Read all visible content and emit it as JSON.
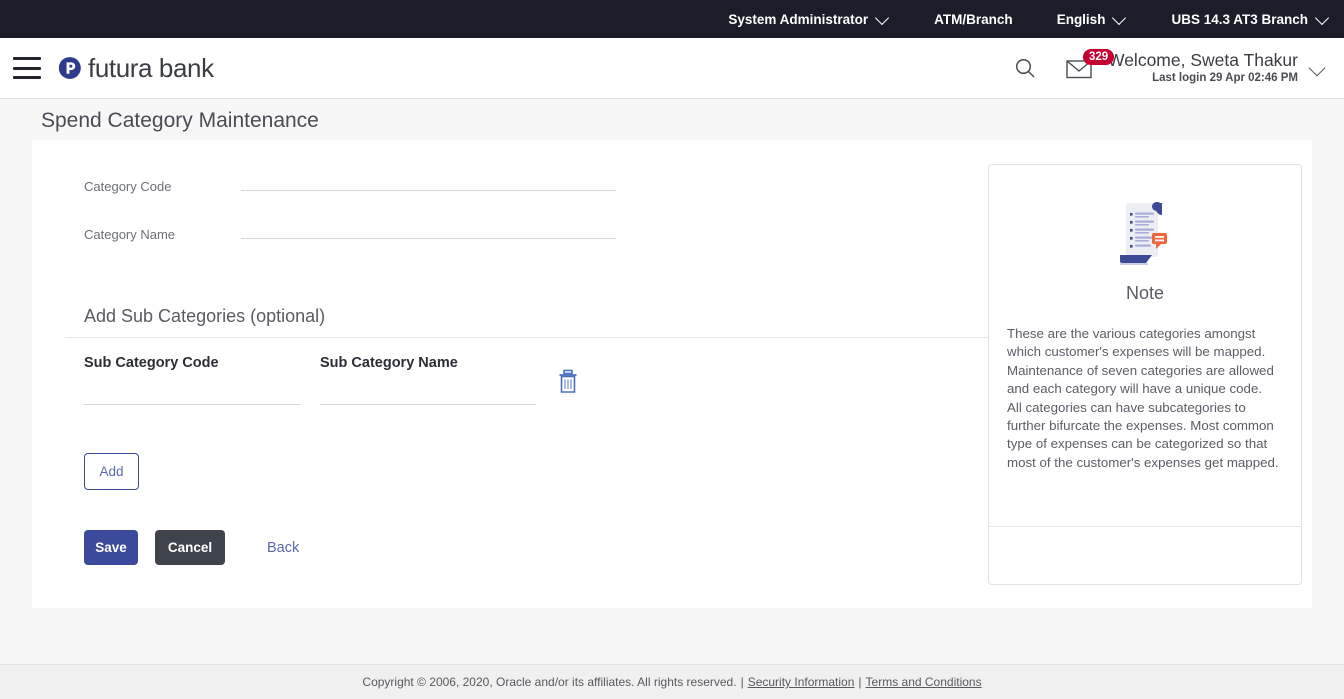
{
  "topbar": {
    "items": [
      {
        "label": "System Administrator",
        "has_caret": true,
        "icon": "chevron-down-icon"
      },
      {
        "label": "ATM/Branch",
        "has_caret": false,
        "icon": ""
      },
      {
        "label": "English",
        "has_caret": true,
        "icon": "chevron-down-icon"
      },
      {
        "label": "UBS 14.3 AT3 Branch",
        "has_caret": true,
        "icon": "chevron-down-icon"
      }
    ]
  },
  "header": {
    "menu_icon": "hamburger-icon",
    "logo_icon": "futura-bank-logo-icon",
    "brand": "futura bank",
    "search_icon": "search-icon",
    "mail_icon": "mail-icon",
    "mail_badge": "329",
    "welcome": "Welcome, Sweta Thakur",
    "last_login": "Last login 29 Apr 02:46 PM",
    "user_caret_icon": "chevron-down-icon"
  },
  "page": {
    "title": "Spend Category Maintenance"
  },
  "form": {
    "category_code": {
      "label": "Category Code",
      "value": "",
      "placeholder": ""
    },
    "category_name": {
      "label": "Category Name",
      "value": "",
      "placeholder": ""
    }
  },
  "subcategories": {
    "section_title": "Add Sub Categories (optional)",
    "columns": [
      "Sub Category Code",
      "Sub Category Name"
    ],
    "delete_icon": "trash-icon",
    "rows": [
      {
        "code": "",
        "name": ""
      }
    ],
    "add_label": "Add"
  },
  "actions": {
    "save_label": "Save",
    "cancel_label": "Cancel",
    "back_label": "Back"
  },
  "note": {
    "icon": "note-document-icon",
    "heading": "Note",
    "body": "These are the various categories amongst which customer's expenses will be mapped. Maintenance of seven categories are allowed and each category will have a unique code.\nAll categories can have subcategories to further bifurcate the expenses. Most common type of expenses can be categorized so that most of the customer's expenses get mapped."
  },
  "footer": {
    "copyright": "Copyright © 2006, 2020, Oracle and/or its affiliates. All rights reserved.",
    "security_link": "Security Information",
    "terms_link": "Terms and Conditions",
    "separator": "|"
  },
  "colors": {
    "topbar_bg": "#1b1d29",
    "primary": "#3b4a9a",
    "cancel": "#3f434c",
    "badge": "#c3002f",
    "link": "#5a6aae"
  }
}
